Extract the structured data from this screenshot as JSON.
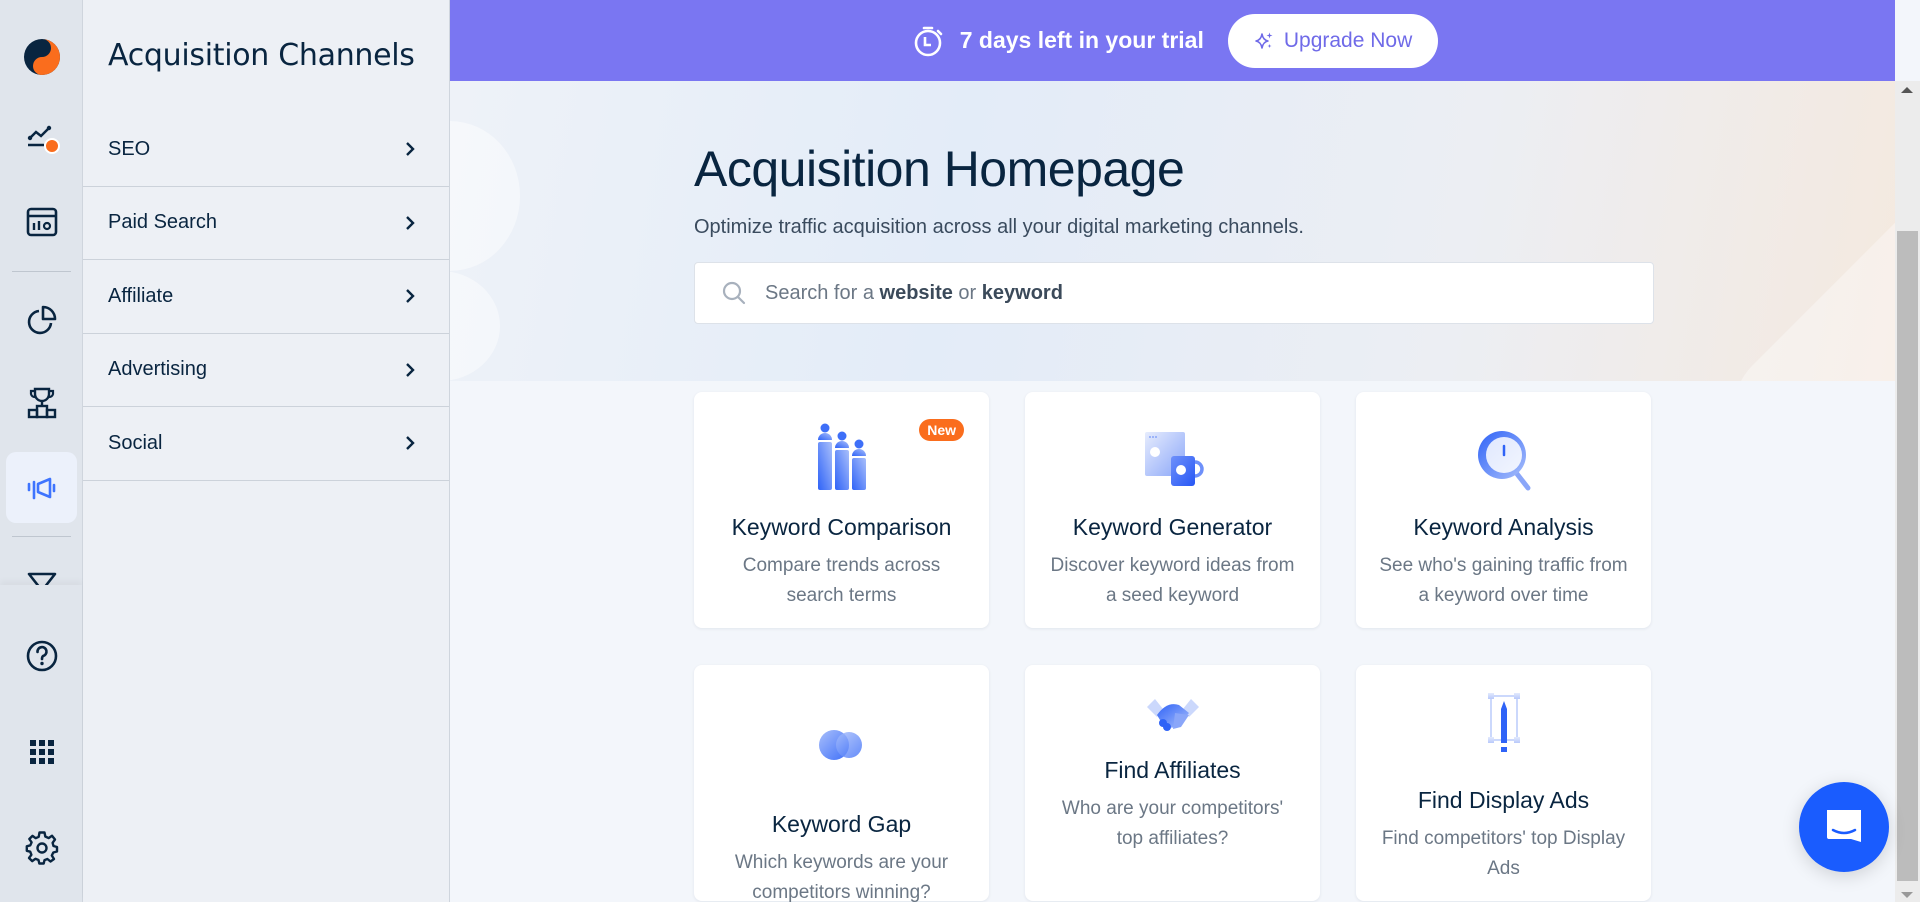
{
  "rail": {
    "items": [
      {
        "name": "trends-icon",
        "active": false
      },
      {
        "name": "dashboard-icon",
        "active": false
      },
      {
        "name": "pie-chart-icon",
        "active": false
      },
      {
        "name": "trophy-icon",
        "active": false
      },
      {
        "name": "megaphone-icon",
        "active": true
      },
      {
        "name": "funnel-icon",
        "active": false
      }
    ],
    "bottom_items": [
      "help-icon",
      "apps-grid-icon",
      "settings-icon"
    ],
    "notification_color": "#fa6d1d"
  },
  "panel": {
    "title": "Acquisition Channels",
    "items": [
      {
        "label": "SEO"
      },
      {
        "label": "Paid Search"
      },
      {
        "label": "Affiliate"
      },
      {
        "label": "Advertising"
      },
      {
        "label": "Social"
      }
    ]
  },
  "banner": {
    "trial_text": "7 days left in your trial",
    "upgrade_label": "Upgrade Now",
    "color": "#7a76f2"
  },
  "hero": {
    "title": "Acquisition Homepage",
    "subtitle": "Optimize traffic acquisition across all your digital marketing channels.",
    "search": {
      "placeholder_prefix": "Search for a ",
      "placeholder_word1": "website",
      "placeholder_mid": " or ",
      "placeholder_word2": "keyword"
    }
  },
  "cards": [
    {
      "title": "Keyword Comparison",
      "description": "Compare trends across search terms",
      "badge": "New",
      "icon": "keyword-comparison-icon"
    },
    {
      "title": "Keyword Generator",
      "description": "Discover keyword ideas from a seed keyword",
      "icon": "keyword-generator-icon"
    },
    {
      "title": "Keyword Analysis",
      "description": "See who's gaining traffic from a keyword over time",
      "icon": "keyword-analysis-icon"
    },
    {
      "title": "Keyword Gap",
      "description": "Which keywords are your competitors winning?",
      "icon": "keyword-gap-icon"
    },
    {
      "title": "Find Affiliates",
      "description": "Who are your competitors' top affiliates?",
      "icon": "handshake-icon"
    },
    {
      "title": "Find Display Ads",
      "description": "Find competitors' top Display Ads",
      "icon": "display-ads-icon"
    }
  ],
  "chat": {
    "label": "chat-support",
    "color": "#1a5cfe"
  }
}
